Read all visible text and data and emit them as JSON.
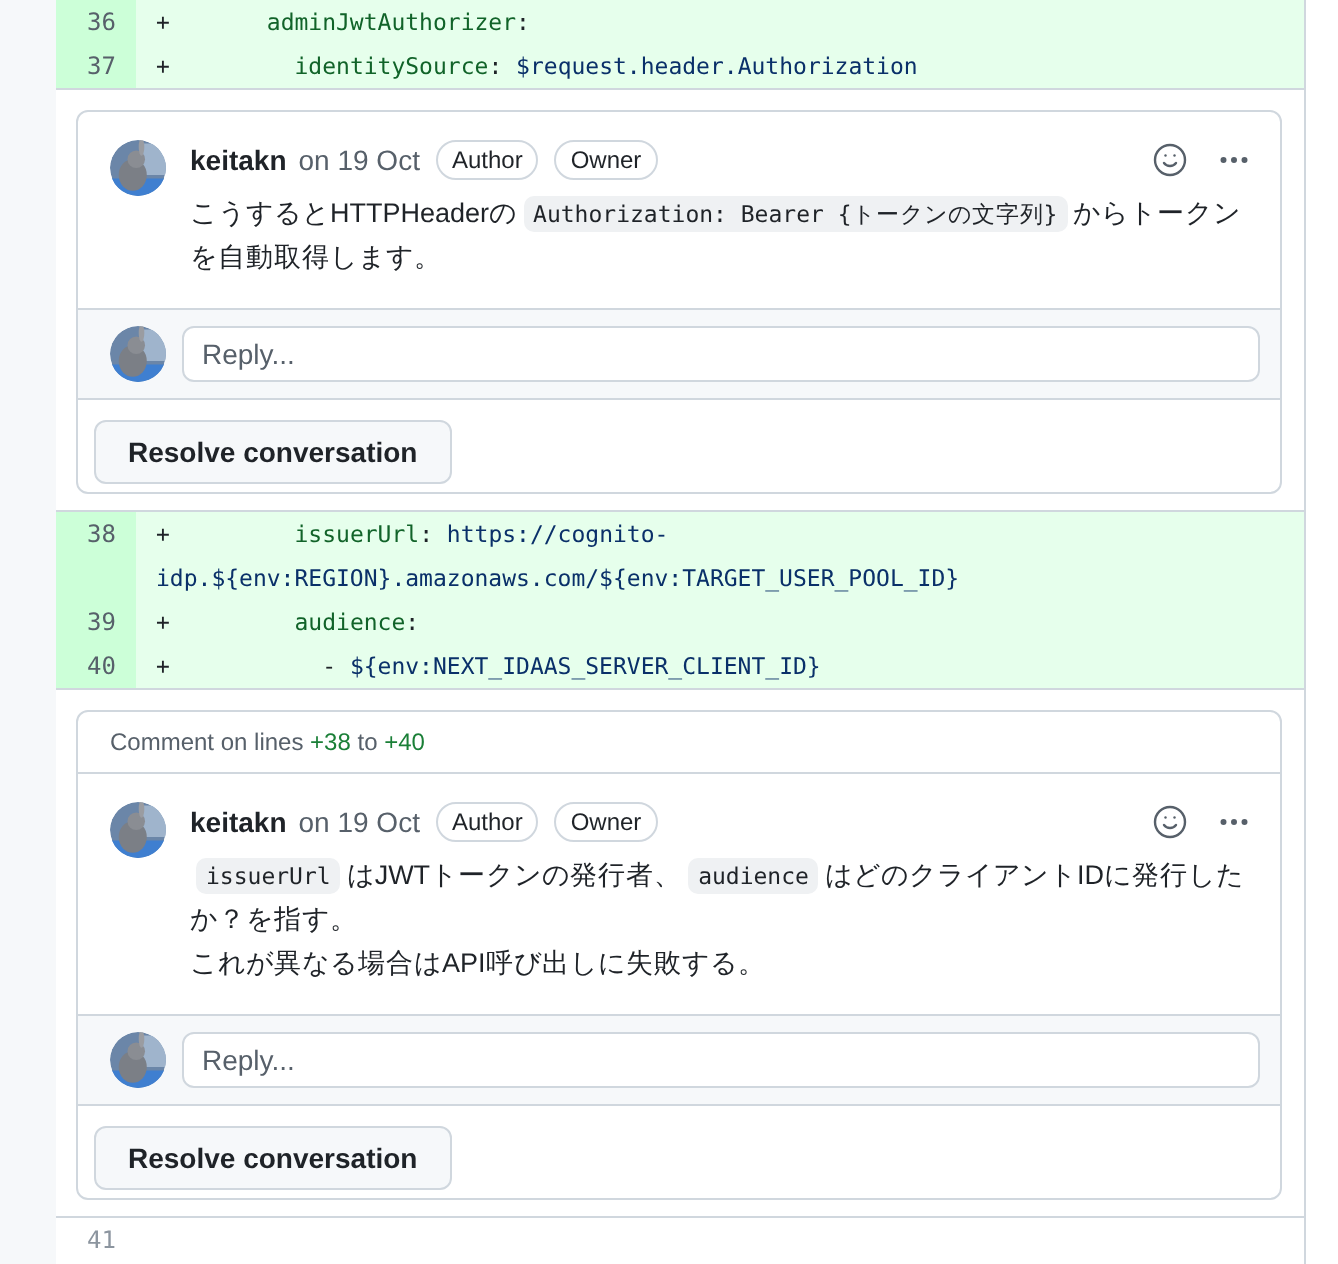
{
  "diff_blocks": [
    {
      "lines": [
        {
          "number": "36",
          "added": true,
          "tokens": [
            {
              "kind": "plain",
              "text": "+       "
            },
            {
              "kind": "key",
              "text": "adminJwtAuthorizer"
            },
            {
              "kind": "plain",
              "text": ":"
            }
          ]
        },
        {
          "number": "37",
          "added": true,
          "tokens": [
            {
              "kind": "plain",
              "text": "+         "
            },
            {
              "kind": "key",
              "text": "identitySource"
            },
            {
              "kind": "plain",
              "text": ": "
            },
            {
              "kind": "value",
              "text": "$request.header.Authorization"
            }
          ]
        }
      ],
      "thread": {
        "comments": [
          {
            "author": "keitakn",
            "date": "on 19 Oct",
            "badges": [
              "Author",
              "Owner"
            ],
            "paragraphs": [
              [
                {
                  "kind": "text",
                  "text": "こうするとHTTPHeaderの"
                },
                {
                  "kind": "code",
                  "text": "Authorization: Bearer {トークンの文字列}"
                },
                {
                  "kind": "text",
                  "text": "からトークンを自動取得します。"
                }
              ]
            ]
          }
        ],
        "reply_placeholder": "Reply...",
        "resolve_label": "Resolve conversation"
      }
    },
    {
      "lines": [
        {
          "number": "38",
          "added": true,
          "tokens": [
            {
              "kind": "plain",
              "text": "+         "
            },
            {
              "kind": "key",
              "text": "issuerUrl"
            },
            {
              "kind": "plain",
              "text": ": "
            },
            {
              "kind": "value",
              "text": "https://cognito-idp.${env:REGION}.amazonaws.com/${env:TARGET_USER_POOL_ID}"
            }
          ]
        },
        {
          "number": "39",
          "added": true,
          "tokens": [
            {
              "kind": "plain",
              "text": "+         "
            },
            {
              "kind": "key",
              "text": "audience"
            },
            {
              "kind": "plain",
              "text": ":"
            }
          ]
        },
        {
          "number": "40",
          "added": true,
          "tokens": [
            {
              "kind": "plain",
              "text": "+           - "
            },
            {
              "kind": "value",
              "text": "${env:NEXT_IDAAS_SERVER_CLIENT_ID}"
            }
          ]
        }
      ],
      "thread": {
        "range": [
          {
            "kind": "text",
            "text": "Comment on lines "
          },
          {
            "kind": "line",
            "text": "+38"
          },
          {
            "kind": "text",
            "text": " to "
          },
          {
            "kind": "line",
            "text": "+40"
          }
        ],
        "comments": [
          {
            "author": "keitakn",
            "date": "on 19 Oct",
            "badges": [
              "Author",
              "Owner"
            ],
            "paragraphs": [
              [
                {
                  "kind": "code",
                  "text": "issuerUrl"
                },
                {
                  "kind": "text",
                  "text": "はJWTトークンの発行者、"
                },
                {
                  "kind": "code",
                  "text": "audience"
                },
                {
                  "kind": "text",
                  "text": "はどのクライアントIDに発行したか？を指す。"
                }
              ],
              [
                {
                  "kind": "text",
                  "text": "これが異なる場合はAPI呼び出しに失敗する。"
                }
              ]
            ]
          }
        ],
        "reply_placeholder": "Reply...",
        "resolve_label": "Resolve conversation"
      }
    },
    {
      "lines": [
        {
          "number": "41",
          "added": false
        }
      ]
    }
  ]
}
